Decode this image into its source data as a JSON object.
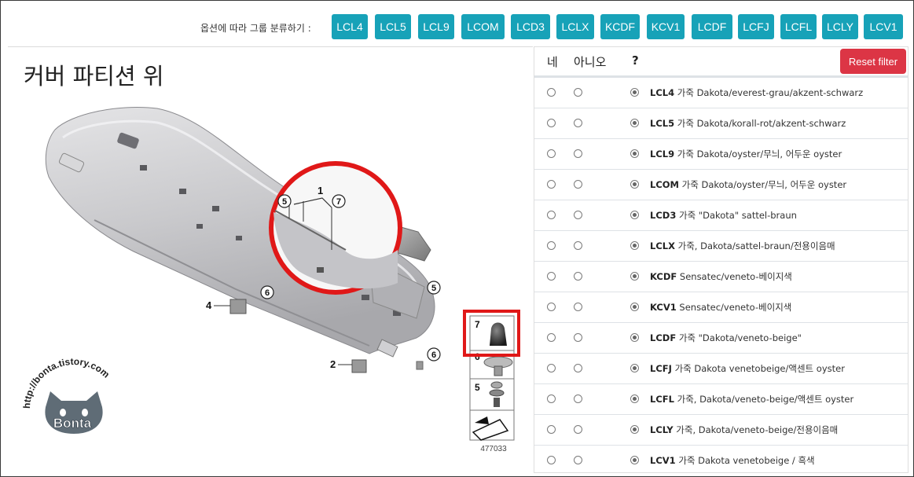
{
  "filter": {
    "label": "옵션에 따라 그룹 분류하기 :",
    "options": [
      "LCL4",
      "LCL5",
      "LCL9",
      "LCOM",
      "LCD3",
      "LCLX",
      "KCDF",
      "KCV1",
      "LCDF",
      "LCFJ",
      "LCFL",
      "LCLY",
      "LCV1"
    ]
  },
  "page": {
    "title": "커버 파티션 위"
  },
  "diagram": {
    "callouts": {
      "c1": "1",
      "c2": "2",
      "c4": "4",
      "c5a": "5",
      "c5b": "5",
      "c6a": "6",
      "c6b": "6",
      "c7": "7"
    },
    "legend": {
      "item7": "7",
      "item6": "6",
      "item5": "5",
      "ref": "477033"
    },
    "watermark": {
      "url": "http://bonta.tistory.com",
      "name": "Bonta"
    }
  },
  "table": {
    "headers": {
      "yes": "네",
      "no": "아니오",
      "question": "?"
    },
    "reset_label": "Reset filter",
    "rows": [
      {
        "code": "LCL4",
        "desc": "가죽 Dakota/everest-grau/akzent-schwarz"
      },
      {
        "code": "LCL5",
        "desc": "가죽 Dakota/korall-rot/akzent-schwarz"
      },
      {
        "code": "LCL9",
        "desc": "가죽 Dakota/oyster/무늬, 어두운 oyster"
      },
      {
        "code": "LCOM",
        "desc": "가죽 Dakota/oyster/무늬, 어두운 oyster"
      },
      {
        "code": "LCD3",
        "desc": "가죽 \"Dakota\" sattel-braun"
      },
      {
        "code": "LCLX",
        "desc": "가죽, Dakota/sattel-braun/전용이음매"
      },
      {
        "code": "KCDF",
        "desc": "Sensatec/veneto-베이지색"
      },
      {
        "code": "KCV1",
        "desc": "Sensatec/veneto-베이지색"
      },
      {
        "code": "LCDF",
        "desc": "가죽 \"Dakota/veneto-beige\""
      },
      {
        "code": "LCFJ",
        "desc": "가죽 Dakota venetobeige/액센트 oyster"
      },
      {
        "code": "LCFL",
        "desc": "가죽, Dakota/veneto-beige/액센트 oyster"
      },
      {
        "code": "LCLY",
        "desc": "가죽, Dakota/veneto-beige/전용이음매"
      },
      {
        "code": "LCV1",
        "desc": "가죽 Dakota venetobeige / 흑색"
      }
    ]
  },
  "colors": {
    "accent": "#17a2b8",
    "danger": "#dc3545",
    "highlight": "#e01818"
  }
}
